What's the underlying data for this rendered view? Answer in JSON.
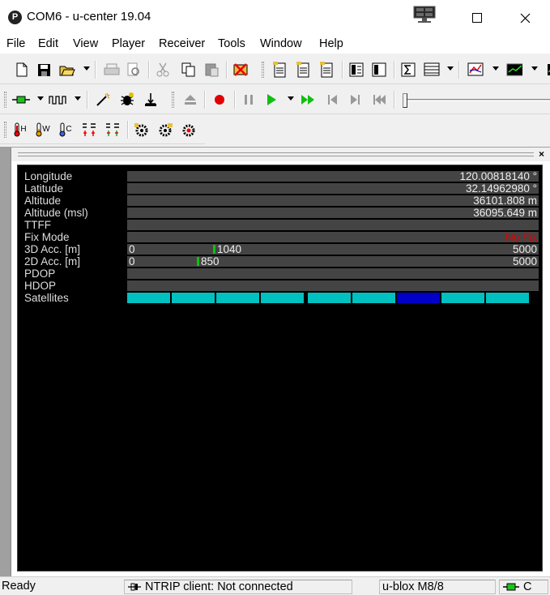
{
  "window": {
    "title": "COM6 - u-center 19.04",
    "logo_letter": "P"
  },
  "menu": [
    "File",
    "Edit",
    "View",
    "Player",
    "Receiver",
    "Tools",
    "Window",
    "Help"
  ],
  "toolbar3": {
    "btn_h": "H",
    "btn_w": "W",
    "btn_c": "C"
  },
  "panel": {
    "rows": [
      {
        "label": "Longitude",
        "value": "120.00818140 °"
      },
      {
        "label": "Latitude",
        "value": "32.14962980 °"
      },
      {
        "label": "Altitude",
        "value": "36101.808 m"
      },
      {
        "label": "Altitude (msl)",
        "value": "36095.649 m"
      },
      {
        "label": "TTFF",
        "value": ""
      },
      {
        "label": "Fix Mode",
        "value": "No Fix"
      }
    ],
    "acc3d": {
      "label": "3D Acc. [m]",
      "min": "0",
      "value": "1040",
      "max": "5000",
      "fraction": 0.208
    },
    "acc2d": {
      "label": "2D Acc. [m]",
      "min": "0",
      "value": "850",
      "max": "5000",
      "fraction": 0.17
    },
    "pdop": {
      "label": "PDOP"
    },
    "hdop": {
      "label": "HDOP"
    },
    "satellites": {
      "label": "Satellites",
      "bars": [
        {
          "color": "#00c0c0"
        },
        {
          "color": "#00c0c0"
        },
        {
          "color": "#00c0c0"
        },
        {
          "color": "#00c0c0"
        },
        {
          "color": "#00c0c0"
        },
        {
          "color": "#00c0c0"
        },
        {
          "color": "#0000c8"
        },
        {
          "color": "#00c0c0"
        },
        {
          "color": "#00c0c0"
        }
      ]
    },
    "colors": {
      "fix_text": "#e00000",
      "bar_green": "#10c010",
      "sat_cyan": "#00c0c0",
      "sat_blue": "#0000c8"
    }
  },
  "status": {
    "ready": "Ready",
    "ntrip": "NTRIP client: Not connected",
    "receiver": "u-blox M8/8",
    "conn": "C"
  }
}
